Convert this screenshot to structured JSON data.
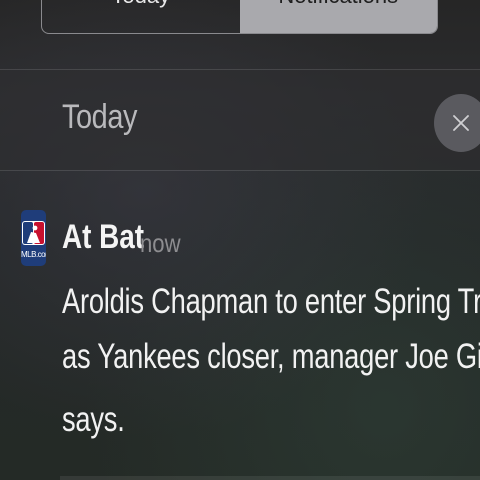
{
  "tabs": [
    {
      "label": "Today",
      "active": true
    },
    {
      "label": "Notifications",
      "active": false
    }
  ],
  "section": {
    "title": "Today",
    "clear_icon": "close-icon"
  },
  "notification": {
    "app_icon": "mlb-app-icon",
    "app_icon_text": "MLB.com",
    "app_name": "At Bat",
    "timestamp": "now",
    "message_lines": [
      "Aroldis Chapman to enter Spring Training",
      "as Yankees closer, manager Joe Girardi",
      "says."
    ]
  },
  "colors": {
    "tab_inactive_bg": "#a9a9ad",
    "clear_button_bg": "#5a5a5f",
    "app_icon_bg": "#1f3d7a",
    "text_primary": "#f2f2f2",
    "text_secondary": "#8d8d90"
  }
}
